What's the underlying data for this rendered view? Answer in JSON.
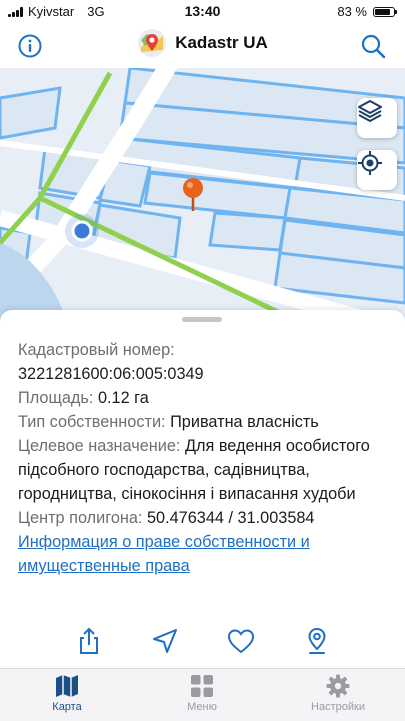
{
  "status_bar": {
    "carrier": "Kyivstar",
    "network": "3G",
    "time": "13:40",
    "battery": "83 %",
    "battery_level": 0.83
  },
  "nav": {
    "title": "Kadastr UA",
    "info_icon": "info-icon",
    "search_icon": "search-icon"
  },
  "map": {
    "layers_icon": "layers-icon",
    "locate_icon": "locate-icon",
    "pin_color": "#e8621d",
    "location_color": "#3a7bd5",
    "parcel_color": "#6fb4f0",
    "highlight_color": "#8fd14f"
  },
  "details": {
    "cadastral_label": "Кадастровый номер:",
    "cadastral_value": "3221281600:06:005:0349",
    "area_label": "Площадь:",
    "area_value": "0.12 га",
    "ownership_label": "Тип собственности:",
    "ownership_value": "Приватна власність",
    "purpose_label": "Целевое назначение:",
    "purpose_value": "Для ведення особистого підсобного господарства, садівництва, городництва, сінокосіння і випасання худоби",
    "center_label": "Центр полигона:",
    "center_value": "50.476344 / 31.003584",
    "rights_link": "Информация о праве собственности и имущественные права"
  },
  "actions": [
    "share-icon",
    "navigate-icon",
    "favorite-icon",
    "pin-icon"
  ],
  "tabs": [
    {
      "label": "Карта",
      "icon": "map-icon",
      "active": true
    },
    {
      "label": "Меню",
      "icon": "grid-icon",
      "active": false
    },
    {
      "label": "Настройки",
      "icon": "gear-icon",
      "active": false
    }
  ],
  "colors": {
    "accent": "#1f6fc5",
    "tab_active": "#1b4f85",
    "tab_inactive": "#9a9aa0"
  }
}
